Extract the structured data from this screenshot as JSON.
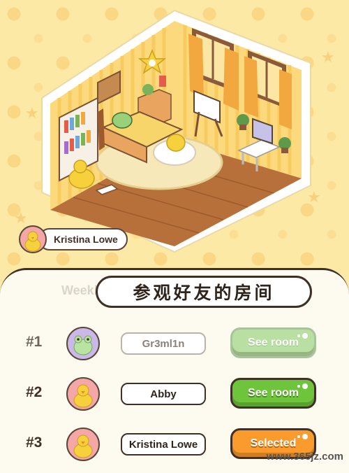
{
  "player": {
    "name": "Kristina Lowe"
  },
  "panel": {
    "tab_partial": "Weekl",
    "title": "参观好友的房间"
  },
  "friends": [
    {
      "rank": "#1",
      "name": "Gr3ml1n",
      "button": "See room",
      "avatar_color": "#c9b8e8",
      "avatar": "frog-avatar-icon"
    },
    {
      "rank": "#2",
      "name": "Abby",
      "button": "See room",
      "avatar_color": "#f5a7a7",
      "avatar": "duck-avatar-icon"
    },
    {
      "rank": "#3",
      "name": "Kristina Lowe",
      "button": "Selected",
      "avatar_color": "#f5a7a7",
      "avatar": "duck-avatar-icon"
    }
  ],
  "watermark": "www.365jz.com",
  "colors": {
    "see_room": "#6ec43a",
    "selected": "#fb9a2d",
    "background": "#fde9a6"
  }
}
